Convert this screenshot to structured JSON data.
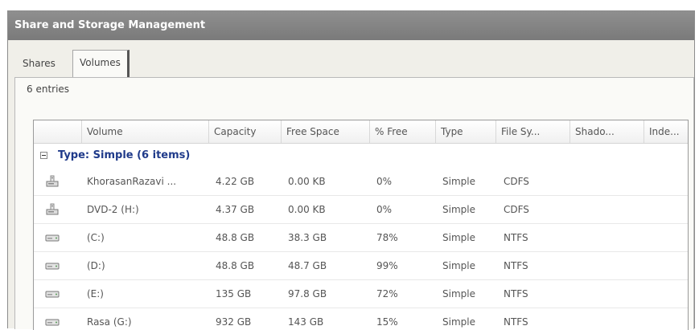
{
  "window": {
    "title": "Share and Storage Management"
  },
  "tabs": [
    {
      "label": "Shares"
    },
    {
      "label": "Volumes"
    }
  ],
  "entries_label": "6 entries",
  "columns": [
    "Volume",
    "Capacity",
    "Free Space",
    "% Free",
    "Type",
    "File Sy...",
    "Shado...",
    "Inde..."
  ],
  "group": {
    "label": "Type: Simple (6 items)"
  },
  "rows": [
    {
      "icon": "cdrom-drive-icon",
      "volume": "KhorasanRazavi ...",
      "capacity": "4.22 GB",
      "free": "0.00 KB",
      "pct": "0%",
      "type": "Simple",
      "fs": "CDFS"
    },
    {
      "icon": "cdrom-drive-icon",
      "volume": "DVD-2 (H:)",
      "capacity": "4.37 GB",
      "free": "0.00 KB",
      "pct": "0%",
      "type": "Simple",
      "fs": "CDFS"
    },
    {
      "icon": "hard-drive-icon",
      "volume": "(C:)",
      "capacity": "48.8 GB",
      "free": "38.3 GB",
      "pct": "78%",
      "type": "Simple",
      "fs": "NTFS"
    },
    {
      "icon": "hard-drive-icon",
      "volume": "(D:)",
      "capacity": "48.8 GB",
      "free": "48.7 GB",
      "pct": "99%",
      "type": "Simple",
      "fs": "NTFS"
    },
    {
      "icon": "hard-drive-icon",
      "volume": "(E:)",
      "capacity": "135 GB",
      "free": "97.8 GB",
      "pct": "72%",
      "type": "Simple",
      "fs": "NTFS"
    },
    {
      "icon": "hard-drive-icon",
      "volume": "Rasa (G:)",
      "capacity": "932 GB",
      "free": "143 GB",
      "pct": "15%",
      "type": "Simple",
      "fs": "NTFS"
    }
  ]
}
